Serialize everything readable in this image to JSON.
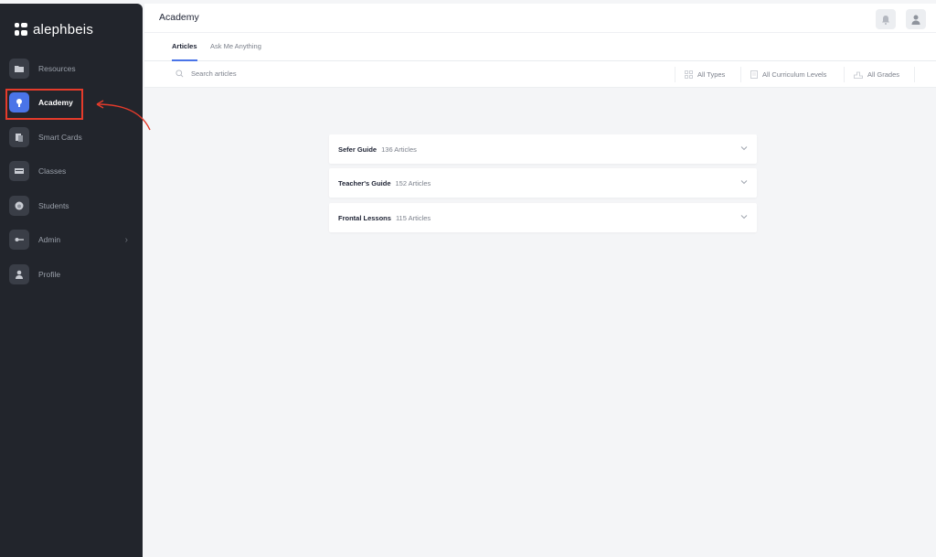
{
  "brand": {
    "name": "alephbeis"
  },
  "sidebar": {
    "items": [
      {
        "label": "Resources",
        "icon": "folder-icon"
      },
      {
        "label": "Academy",
        "icon": "lightbulb-icon",
        "active": true
      },
      {
        "label": "Smart Cards",
        "icon": "cards-icon"
      },
      {
        "label": "Classes",
        "icon": "classroom-icon"
      },
      {
        "label": "Students",
        "icon": "student-icon"
      },
      {
        "label": "Admin",
        "icon": "key-icon",
        "has_submenu": true
      },
      {
        "label": "Profile",
        "icon": "person-icon"
      }
    ]
  },
  "header": {
    "title": "Academy"
  },
  "tabs": [
    {
      "label": "Articles",
      "active": true
    },
    {
      "label": "Ask Me Anything",
      "active": false
    }
  ],
  "filters": {
    "search_placeholder": "Search articles",
    "types": "All Types",
    "curriculum": "All Curriculum Levels",
    "grades": "All Grades"
  },
  "sections": [
    {
      "title": "Sefer Guide",
      "count": "136 Articles"
    },
    {
      "title": "Teacher's Guide",
      "count": "152 Articles"
    },
    {
      "title": "Frontal Lessons",
      "count": "115 Articles"
    }
  ],
  "colors": {
    "sidebar_bg": "#22252c",
    "accent": "#4a74e8",
    "highlight": "#e53b2b"
  }
}
